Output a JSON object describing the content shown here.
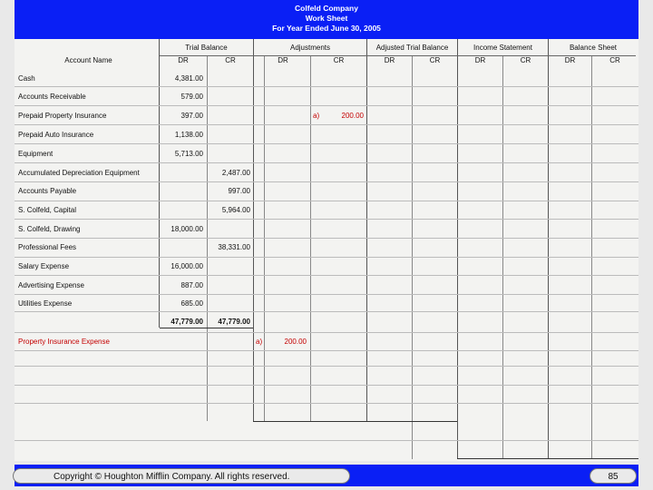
{
  "worksheet": {
    "company": "Colfeld Company",
    "title": "Work Sheet",
    "period": "For Year Ended June 30, 2005",
    "headers": {
      "account_name": "Account Name",
      "trial_balance": "Trial Balance",
      "adjustments": "Adjustments",
      "adjusted_trial_balance": "Adjusted Trial Balance",
      "income_statement": "Income Statement",
      "balance_sheet": "Balance Sheet",
      "dr": "DR",
      "cr": "CR"
    },
    "rows": [
      {
        "account": "Cash",
        "tb_dr": "4,381.00",
        "tb_cr": ""
      },
      {
        "account": "Accounts Receivable",
        "tb_dr": "579.00",
        "tb_cr": ""
      },
      {
        "account": "Prepaid Property Insurance",
        "tb_dr": "397.00",
        "tb_cr": "",
        "adj_tag": "a)",
        "adj_cr": "200.00"
      },
      {
        "account": "Prepaid Auto Insurance",
        "tb_dr": "1,138.00",
        "tb_cr": ""
      },
      {
        "account": "Equipment",
        "tb_dr": "5,713.00",
        "tb_cr": ""
      },
      {
        "account": "Accumulated Depreciation Equipment",
        "tb_dr": "",
        "tb_cr": "2,487.00"
      },
      {
        "account": "Accounts Payable",
        "tb_dr": "",
        "tb_cr": "997.00"
      },
      {
        "account": "S. Colfeld, Capital",
        "tb_dr": "",
        "tb_cr": "5,964.00"
      },
      {
        "account": "S. Colfeld, Drawing",
        "tb_dr": "18,000.00",
        "tb_cr": ""
      },
      {
        "account": "Professional Fees",
        "tb_dr": "",
        "tb_cr": "38,331.00"
      },
      {
        "account": "Salary Expense",
        "tb_dr": "16,000.00",
        "tb_cr": ""
      },
      {
        "account": "Advertising Expense",
        "tb_dr": "887.00",
        "tb_cr": ""
      },
      {
        "account": "Utilities Expense",
        "tb_dr": "685.00",
        "tb_cr": ""
      }
    ],
    "totals": {
      "tb_dr": "47,779.00",
      "tb_cr": "47,779.00"
    },
    "added_row": {
      "account": "Property Insurance Expense",
      "adj_tag": "a)",
      "adj_dr": "200.00"
    }
  },
  "footer": {
    "copyright": "Copyright © Houghton Mifflin Company. All rights reserved.",
    "page_number": "85"
  },
  "colors": {
    "header_blue": "#0a1ff5",
    "adjustment_red": "#c40000"
  }
}
